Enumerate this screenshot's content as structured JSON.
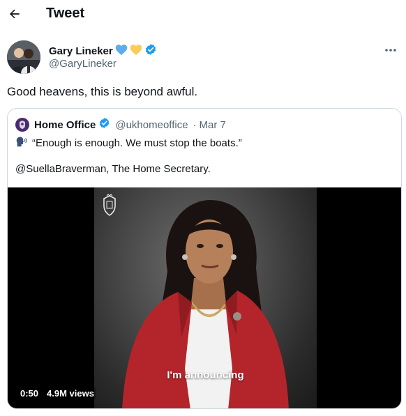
{
  "header": {
    "title": "Tweet",
    "back_icon": "back-arrow-icon"
  },
  "author": {
    "name": "Gary Lineker",
    "handle": "@GaryLineker",
    "emoji_badges": [
      "blue-heart-icon",
      "yellow-heart-icon"
    ],
    "verified_icon": "verified-badge-icon",
    "more_icon": "more-options-icon"
  },
  "tweet": {
    "text": "Good heavens, this is beyond awful."
  },
  "quoted": {
    "name": "Home Office",
    "handle": "@ukhomeoffice",
    "separator": "·",
    "date": "Mar 7",
    "speaking_icon": "speaking-head-icon",
    "line1": "“Enough is enough. We must stop the boats.”",
    "line2": "@SuellaBraverman, The Home Secretary.",
    "video": {
      "caption": "I'm announcing",
      "time": "0:50",
      "views": "4.9M views"
    }
  },
  "colors": {
    "verified": "#1d9bf0",
    "text": "#0f1419",
    "muted": "#536471",
    "border": "#cfd9de",
    "blazer": "#b3252a"
  }
}
